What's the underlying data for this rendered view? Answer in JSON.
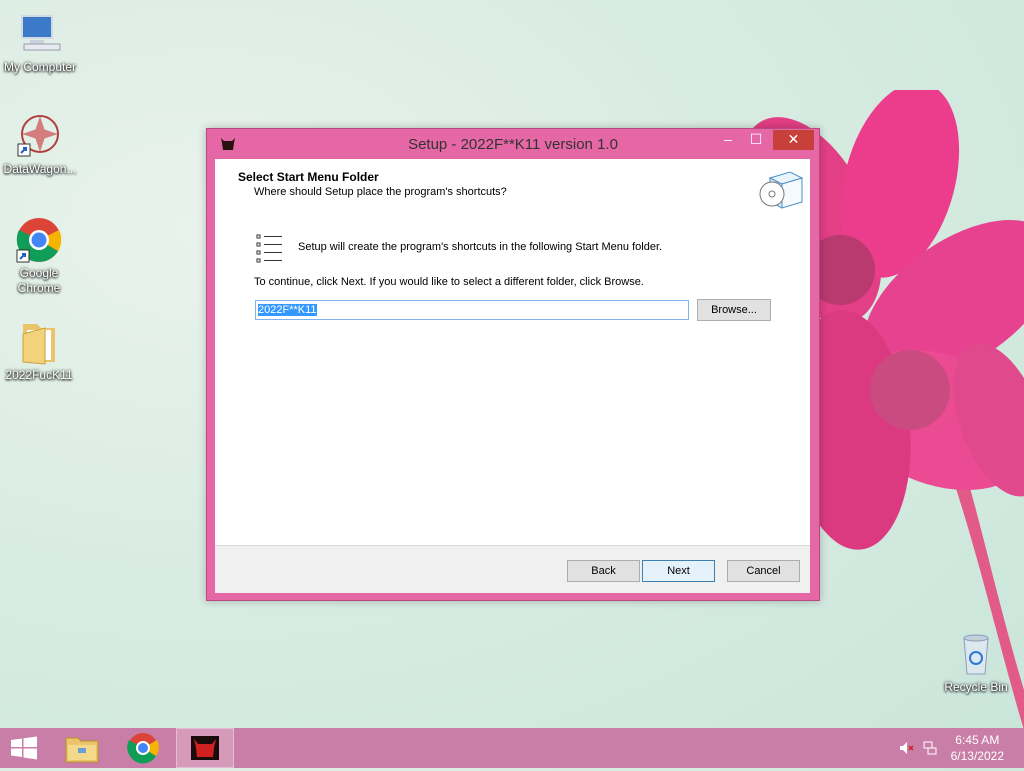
{
  "desktop": {
    "icons": [
      {
        "label": "My Computer"
      },
      {
        "label": "DataWagon..."
      },
      {
        "label": "Google Chrome"
      },
      {
        "label": "2022FucK11"
      },
      {
        "label": "Recycle Bin"
      }
    ]
  },
  "window": {
    "title": "Setup - 2022F**K11 version 1.0",
    "controls": {
      "minimize": "–",
      "maximize": "☐",
      "close": "✕"
    },
    "header": {
      "title": "Select Start Menu Folder",
      "subtitle": "Where should Setup place the program's shortcuts?"
    },
    "info_text": "Setup will create the program's shortcuts in the following Start Menu folder.",
    "continue_text": "To continue, click Next. If you would like to select a different folder, click Browse.",
    "folder_value": "2022F**K11",
    "browse_label": "Browse...",
    "back_label": "Back",
    "next_label": "Next",
    "cancel_label": "Cancel"
  },
  "taskbar": {
    "time": "6:45 AM",
    "date": "6/13/2022"
  },
  "colors": {
    "window_frame": "#e667a5",
    "close_button": "#c7403a",
    "taskbar": "#c97ea7",
    "selection": "#3399ff"
  }
}
